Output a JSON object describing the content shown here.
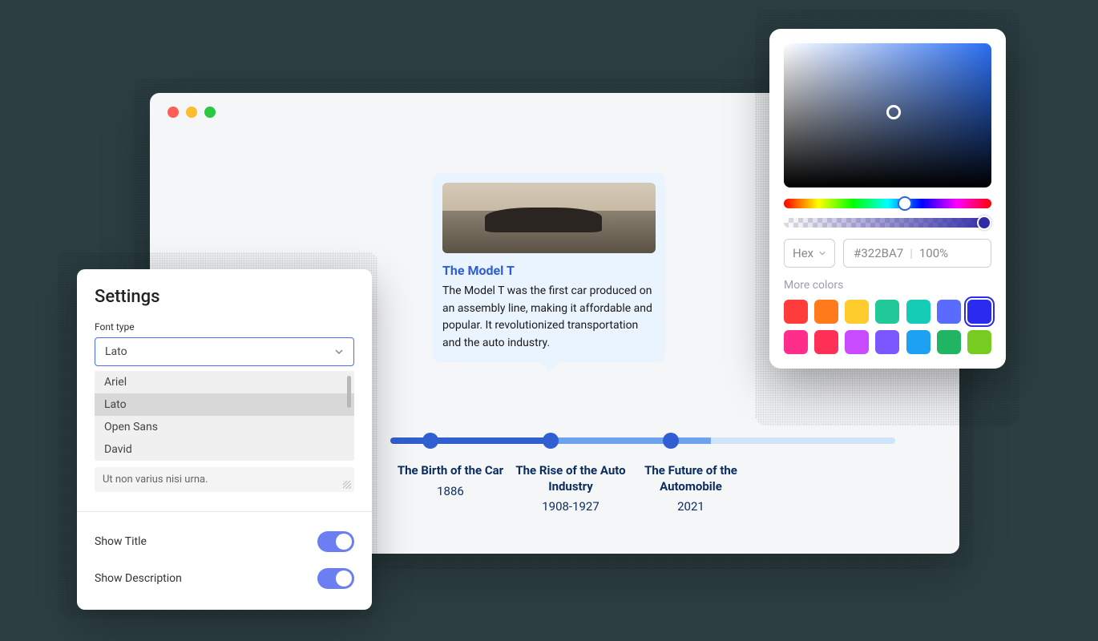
{
  "settings": {
    "title": "Settings",
    "font_type_label": "Font type",
    "selected_font": "Lato",
    "font_options": [
      "Ariel",
      "Lato",
      "Open Sans",
      "David"
    ],
    "description_placeholder": "Ut non varius nisi urna.",
    "show_title_label": "Show Title",
    "show_description_label": "Show Description"
  },
  "timeline": {
    "card": {
      "title": "The Model T",
      "body": "The Model T was the first car produced on an assembly line, making it affordable and popular. It revolutionized transportation and the auto industry."
    },
    "items": [
      {
        "title": "The Birth of the Car",
        "year": "1886"
      },
      {
        "title": "The Rise of the Auto Industry",
        "year": "1908-1927"
      },
      {
        "title": "The Future of the Automobile",
        "year": "2021"
      }
    ]
  },
  "color_picker": {
    "format_label": "Hex",
    "hex_value": "#322BA7",
    "alpha_value": "100%",
    "more_colors_label": "More colors",
    "swatches": [
      "#ff3b3b",
      "#ff7a1a",
      "#ffcc2e",
      "#20c997",
      "#15cdb7",
      "#5a6bff",
      "#2a2af0",
      "#ff2e8a",
      "#ff3055",
      "#c94bff",
      "#7a57ff",
      "#1da1f2",
      "#20b463",
      "#77cc22"
    ],
    "selected_swatch_index": 6
  }
}
